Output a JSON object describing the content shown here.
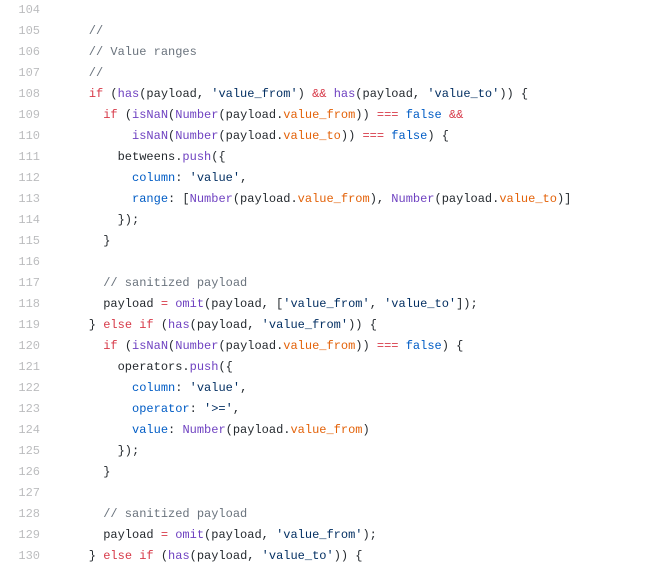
{
  "lines": [
    {
      "num": "104",
      "tokens": []
    },
    {
      "num": "105",
      "tokens": [
        {
          "cls": "c",
          "text": "    //"
        }
      ]
    },
    {
      "num": "106",
      "tokens": [
        {
          "cls": "c",
          "text": "    // Value ranges"
        }
      ]
    },
    {
      "num": "107",
      "tokens": [
        {
          "cls": "c",
          "text": "    //"
        }
      ]
    },
    {
      "num": "108",
      "tokens": [
        {
          "cls": "p",
          "text": "    "
        },
        {
          "cls": "k",
          "text": "if"
        },
        {
          "cls": "p",
          "text": " ("
        },
        {
          "cls": "f",
          "text": "has"
        },
        {
          "cls": "p",
          "text": "(payload, "
        },
        {
          "cls": "s",
          "text": "'value_from'"
        },
        {
          "cls": "p",
          "text": ") "
        },
        {
          "cls": "k",
          "text": "&&"
        },
        {
          "cls": "p",
          "text": " "
        },
        {
          "cls": "f",
          "text": "has"
        },
        {
          "cls": "p",
          "text": "(payload, "
        },
        {
          "cls": "s",
          "text": "'value_to'"
        },
        {
          "cls": "p",
          "text": ")) {"
        }
      ]
    },
    {
      "num": "109",
      "tokens": [
        {
          "cls": "p",
          "text": "      "
        },
        {
          "cls": "k",
          "text": "if"
        },
        {
          "cls": "p",
          "text": " ("
        },
        {
          "cls": "f",
          "text": "isNaN"
        },
        {
          "cls": "p",
          "text": "("
        },
        {
          "cls": "f",
          "text": "Number"
        },
        {
          "cls": "p",
          "text": "(payload."
        },
        {
          "cls": "v",
          "text": "value_from"
        },
        {
          "cls": "p",
          "text": ")) "
        },
        {
          "cls": "k",
          "text": "==="
        },
        {
          "cls": "p",
          "text": " "
        },
        {
          "cls": "n",
          "text": "false"
        },
        {
          "cls": "p",
          "text": " "
        },
        {
          "cls": "k",
          "text": "&&"
        }
      ]
    },
    {
      "num": "110",
      "tokens": [
        {
          "cls": "p",
          "text": "          "
        },
        {
          "cls": "f",
          "text": "isNaN"
        },
        {
          "cls": "p",
          "text": "("
        },
        {
          "cls": "f",
          "text": "Number"
        },
        {
          "cls": "p",
          "text": "(payload."
        },
        {
          "cls": "v",
          "text": "value_to"
        },
        {
          "cls": "p",
          "text": ")) "
        },
        {
          "cls": "k",
          "text": "==="
        },
        {
          "cls": "p",
          "text": " "
        },
        {
          "cls": "n",
          "text": "false"
        },
        {
          "cls": "p",
          "text": ") {"
        }
      ]
    },
    {
      "num": "111",
      "tokens": [
        {
          "cls": "p",
          "text": "        betweens."
        },
        {
          "cls": "f",
          "text": "push"
        },
        {
          "cls": "p",
          "text": "({"
        }
      ]
    },
    {
      "num": "112",
      "tokens": [
        {
          "cls": "p",
          "text": "          "
        },
        {
          "cls": "n",
          "text": "column"
        },
        {
          "cls": "p",
          "text": ": "
        },
        {
          "cls": "s",
          "text": "'value'"
        },
        {
          "cls": "p",
          "text": ","
        }
      ]
    },
    {
      "num": "113",
      "tokens": [
        {
          "cls": "p",
          "text": "          "
        },
        {
          "cls": "n",
          "text": "range"
        },
        {
          "cls": "p",
          "text": ": ["
        },
        {
          "cls": "f",
          "text": "Number"
        },
        {
          "cls": "p",
          "text": "(payload."
        },
        {
          "cls": "v",
          "text": "value_from"
        },
        {
          "cls": "p",
          "text": "), "
        },
        {
          "cls": "f",
          "text": "Number"
        },
        {
          "cls": "p",
          "text": "(payload."
        },
        {
          "cls": "v",
          "text": "value_to"
        },
        {
          "cls": "p",
          "text": ")]"
        }
      ]
    },
    {
      "num": "114",
      "tokens": [
        {
          "cls": "p",
          "text": "        });"
        }
      ]
    },
    {
      "num": "115",
      "tokens": [
        {
          "cls": "p",
          "text": "      }"
        }
      ]
    },
    {
      "num": "116",
      "tokens": []
    },
    {
      "num": "117",
      "tokens": [
        {
          "cls": "c",
          "text": "      // sanitized payload"
        }
      ]
    },
    {
      "num": "118",
      "tokens": [
        {
          "cls": "p",
          "text": "      payload "
        },
        {
          "cls": "k",
          "text": "="
        },
        {
          "cls": "p",
          "text": " "
        },
        {
          "cls": "f",
          "text": "omit"
        },
        {
          "cls": "p",
          "text": "(payload, ["
        },
        {
          "cls": "s",
          "text": "'value_from'"
        },
        {
          "cls": "p",
          "text": ", "
        },
        {
          "cls": "s",
          "text": "'value_to'"
        },
        {
          "cls": "p",
          "text": "]);"
        }
      ]
    },
    {
      "num": "119",
      "tokens": [
        {
          "cls": "p",
          "text": "    } "
        },
        {
          "cls": "k",
          "text": "else if"
        },
        {
          "cls": "p",
          "text": " ("
        },
        {
          "cls": "f",
          "text": "has"
        },
        {
          "cls": "p",
          "text": "(payload, "
        },
        {
          "cls": "s",
          "text": "'value_from'"
        },
        {
          "cls": "p",
          "text": ")) {"
        }
      ]
    },
    {
      "num": "120",
      "tokens": [
        {
          "cls": "p",
          "text": "      "
        },
        {
          "cls": "k",
          "text": "if"
        },
        {
          "cls": "p",
          "text": " ("
        },
        {
          "cls": "f",
          "text": "isNaN"
        },
        {
          "cls": "p",
          "text": "("
        },
        {
          "cls": "f",
          "text": "Number"
        },
        {
          "cls": "p",
          "text": "(payload."
        },
        {
          "cls": "v",
          "text": "value_from"
        },
        {
          "cls": "p",
          "text": ")) "
        },
        {
          "cls": "k",
          "text": "==="
        },
        {
          "cls": "p",
          "text": " "
        },
        {
          "cls": "n",
          "text": "false"
        },
        {
          "cls": "p",
          "text": ") {"
        }
      ]
    },
    {
      "num": "121",
      "tokens": [
        {
          "cls": "p",
          "text": "        operators."
        },
        {
          "cls": "f",
          "text": "push"
        },
        {
          "cls": "p",
          "text": "({"
        }
      ]
    },
    {
      "num": "122",
      "tokens": [
        {
          "cls": "p",
          "text": "          "
        },
        {
          "cls": "n",
          "text": "column"
        },
        {
          "cls": "p",
          "text": ": "
        },
        {
          "cls": "s",
          "text": "'value'"
        },
        {
          "cls": "p",
          "text": ","
        }
      ]
    },
    {
      "num": "123",
      "tokens": [
        {
          "cls": "p",
          "text": "          "
        },
        {
          "cls": "n",
          "text": "operator"
        },
        {
          "cls": "p",
          "text": ": "
        },
        {
          "cls": "s",
          "text": "'>='"
        },
        {
          "cls": "p",
          "text": ","
        }
      ]
    },
    {
      "num": "124",
      "tokens": [
        {
          "cls": "p",
          "text": "          "
        },
        {
          "cls": "n",
          "text": "value"
        },
        {
          "cls": "p",
          "text": ": "
        },
        {
          "cls": "f",
          "text": "Number"
        },
        {
          "cls": "p",
          "text": "(payload."
        },
        {
          "cls": "v",
          "text": "value_from"
        },
        {
          "cls": "p",
          "text": ")"
        }
      ]
    },
    {
      "num": "125",
      "tokens": [
        {
          "cls": "p",
          "text": "        });"
        }
      ]
    },
    {
      "num": "126",
      "tokens": [
        {
          "cls": "p",
          "text": "      }"
        }
      ]
    },
    {
      "num": "127",
      "tokens": []
    },
    {
      "num": "128",
      "tokens": [
        {
          "cls": "c",
          "text": "      // sanitized payload"
        }
      ]
    },
    {
      "num": "129",
      "tokens": [
        {
          "cls": "p",
          "text": "      payload "
        },
        {
          "cls": "k",
          "text": "="
        },
        {
          "cls": "p",
          "text": " "
        },
        {
          "cls": "f",
          "text": "omit"
        },
        {
          "cls": "p",
          "text": "(payload, "
        },
        {
          "cls": "s",
          "text": "'value_from'"
        },
        {
          "cls": "p",
          "text": ");"
        }
      ]
    },
    {
      "num": "130",
      "tokens": [
        {
          "cls": "p",
          "text": "    } "
        },
        {
          "cls": "k",
          "text": "else if"
        },
        {
          "cls": "p",
          "text": " ("
        },
        {
          "cls": "f",
          "text": "has"
        },
        {
          "cls": "p",
          "text": "(payload, "
        },
        {
          "cls": "s",
          "text": "'value_to'"
        },
        {
          "cls": "p",
          "text": ")) {"
        }
      ]
    }
  ]
}
